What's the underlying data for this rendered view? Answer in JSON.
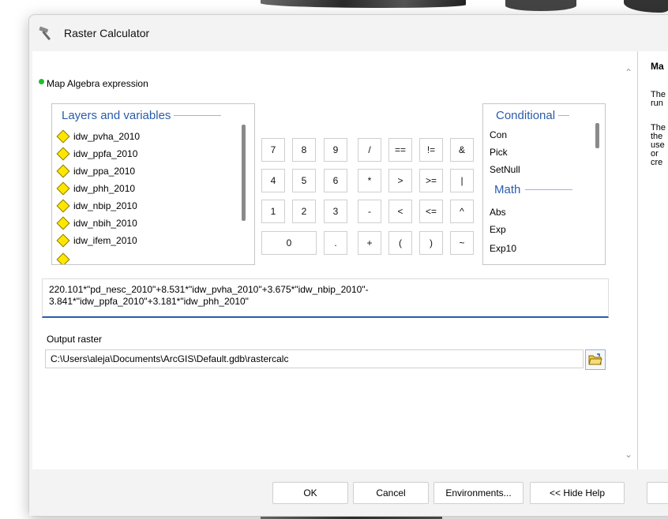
{
  "window": {
    "title": "Raster Calculator"
  },
  "section": {
    "map_algebra_label": "Map Algebra expression"
  },
  "layers": {
    "header": "Layers and variables",
    "items": [
      "idw_pvha_2010",
      "idw_ppfa_2010",
      "idw_ppa_2010",
      "idw_phh_2010",
      "idw_nbip_2010",
      "idw_nbih_2010",
      "idw_ifem_2010"
    ]
  },
  "keypad": {
    "row1": [
      "7",
      "8",
      "9",
      "/",
      "==",
      "!=",
      "&"
    ],
    "row2": [
      "4",
      "5",
      "6",
      "*",
      ">",
      ">=",
      "|"
    ],
    "row3": [
      "1",
      "2",
      "3",
      "-",
      "<",
      "<=",
      "^"
    ],
    "row4": [
      "0",
      ".",
      "+",
      "(",
      ")",
      "~"
    ]
  },
  "functions": {
    "conditional_header": "Conditional",
    "conditional_items": [
      "Con",
      "Pick",
      "SetNull"
    ],
    "math_header": "Math",
    "math_items": [
      "Abs",
      "Exp",
      "Exp10"
    ]
  },
  "expression": {
    "line1": "220.101*\"pd_nesc_2010\"+8.531*\"idw_pvha_2010\"+3.675*\"idw_nbip_2010\"-",
    "line2": "3.841*\"idw_ppfa_2010\"+3.181*\"idw_phh_2010\""
  },
  "output": {
    "label": "Output raster",
    "value": "C:\\Users\\aleja\\Documents\\ArcGIS\\Default.gdb\\rastercalc"
  },
  "help": {
    "title": "Ma",
    "lines": [
      "The",
      "run",
      "",
      "The",
      "the",
      "use",
      "or",
      "cre"
    ]
  },
  "buttons": {
    "ok": "OK",
    "cancel": "Cancel",
    "environments": "Environments...",
    "hide_help": "<< Hide Help"
  }
}
